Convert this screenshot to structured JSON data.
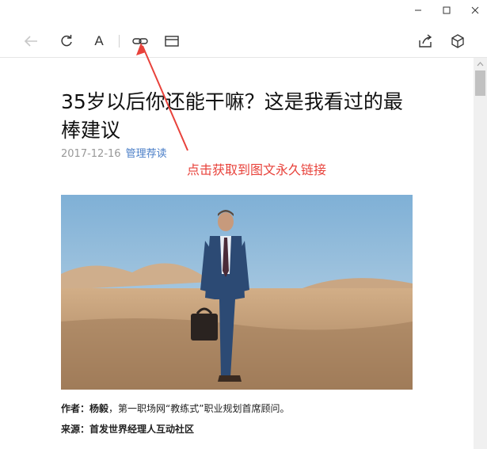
{
  "window": {
    "minimize_icon": "minimize-icon",
    "maximize_icon": "maximize-icon",
    "close_icon": "close-icon"
  },
  "toolbar": {
    "back_icon": "back-arrow-icon",
    "refresh_icon": "refresh-icon",
    "font_icon": "font-icon",
    "font_label": "A",
    "link_icon": "link-icon",
    "window_icon": "browser-window-icon",
    "share_icon": "share-icon",
    "cube_icon": "cube-icon"
  },
  "article": {
    "title": "35岁以后你还能干嘛？这是我看过的最棒建议",
    "date": "2017-12-16",
    "source_link": "管理荐读",
    "author_label": "作者：",
    "author_name": "杨毅",
    "author_desc": "，第一职场网“教练式”职业规划首席顾问。",
    "origin_label": "来源：",
    "origin_name": "首发世界经理人互动社区"
  },
  "annotation": {
    "text": "点击获取到图文永久链接",
    "color": "#e8423b"
  },
  "colors": {
    "link": "#4a7ec7",
    "accent_red": "#e8423b",
    "sky": "#8fb7d6",
    "sand": "#c9a27c"
  }
}
